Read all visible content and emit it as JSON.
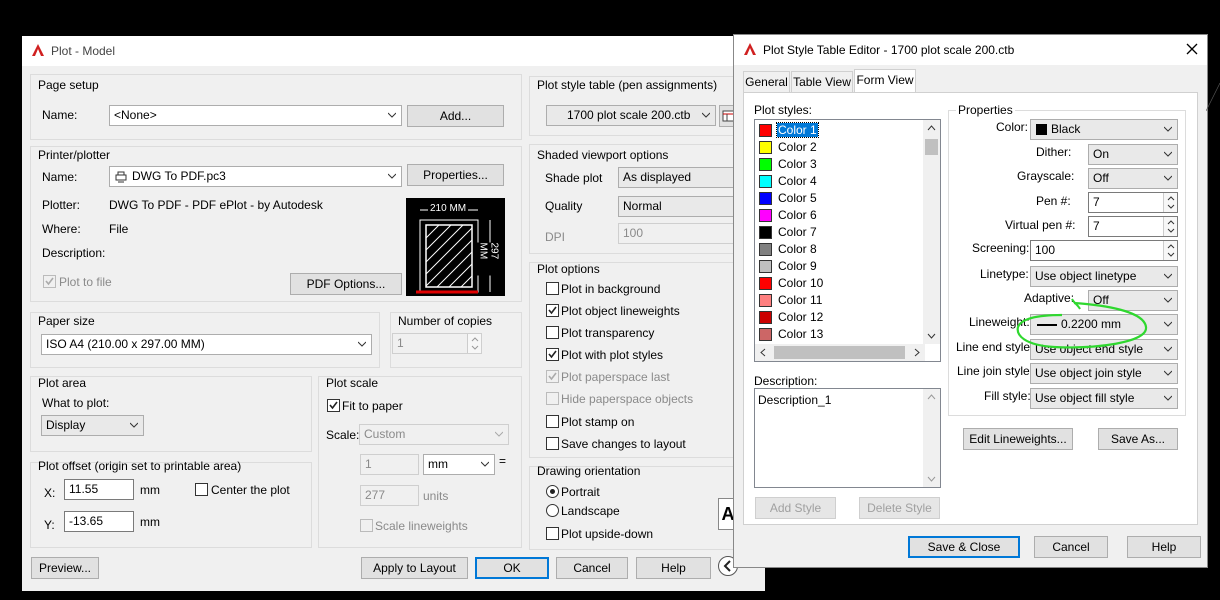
{
  "plot": {
    "title": "Plot - Model",
    "page_setup": {
      "group": "Page setup",
      "name_label": "Name:",
      "name_value": "<None>",
      "add_button": "Add..."
    },
    "printer": {
      "group": "Printer/plotter",
      "name_label": "Name:",
      "name_value": "DWG To PDF.pc3",
      "properties_button": "Properties...",
      "plotter_label": "Plotter:",
      "plotter_value": "DWG To PDF - PDF ePlot - by Autodesk",
      "where_label": "Where:",
      "where_value": "File",
      "description_label": "Description:",
      "plot_to_file_label": "Plot to file",
      "pdf_options_button": "PDF Options...",
      "preview_width": "210 MM",
      "preview_height": "297 MM"
    },
    "paper_size": {
      "group": "Paper size",
      "value": "ISO A4 (210.00 x 297.00 MM)"
    },
    "copies": {
      "group": "Number of copies",
      "value": "1"
    },
    "plot_area": {
      "group": "Plot area",
      "what_label": "What to plot:",
      "what_value": "Display"
    },
    "plot_offset": {
      "group": "Plot offset (origin set to printable area)",
      "x_label": "X:",
      "x_value": "11.55",
      "y_label": "Y:",
      "y_value": "-13.65",
      "unit": "mm",
      "center_label": "Center the plot"
    },
    "plot_scale": {
      "group": "Plot scale",
      "fit_label": "Fit to paper",
      "scale_label": "Scale:",
      "scale_value": "Custom",
      "num_value": "1",
      "unit_value": "mm",
      "equals": "=",
      "den_value": "277",
      "units_label": "units",
      "scale_lw_label": "Scale lineweights"
    },
    "plot_style_table": {
      "group": "Plot style table (pen assignments)",
      "value": "1700 plot scale 200.ctb"
    },
    "shaded": {
      "group": "Shaded viewport options",
      "shade_label": "Shade plot",
      "shade_value": "As displayed",
      "quality_label": "Quality",
      "quality_value": "Normal",
      "dpi_label": "DPI",
      "dpi_value": "100"
    },
    "options": {
      "group": "Plot options",
      "items": [
        {
          "label": "Plot in background",
          "checked": false,
          "disabled": false
        },
        {
          "label": "Plot object lineweights",
          "checked": true,
          "disabled": false
        },
        {
          "label": "Plot transparency",
          "checked": false,
          "disabled": false
        },
        {
          "label": "Plot with plot styles",
          "checked": true,
          "disabled": false
        },
        {
          "label": "Plot paperspace last",
          "checked": true,
          "disabled": true
        },
        {
          "label": "Hide paperspace objects",
          "checked": false,
          "disabled": true
        },
        {
          "label": "Plot stamp on",
          "checked": false,
          "disabled": false
        },
        {
          "label": "Save changes to layout",
          "checked": false,
          "disabled": false
        }
      ]
    },
    "orientation": {
      "group": "Drawing orientation",
      "portrait": "Portrait",
      "landscape": "Landscape",
      "upside": "Plot upside-down"
    },
    "buttons": {
      "preview": "Preview...",
      "apply": "Apply to Layout",
      "ok": "OK",
      "cancel": "Cancel",
      "help": "Help"
    }
  },
  "editor": {
    "title": "Plot Style Table Editor - 1700 plot scale 200.ctb",
    "tabs": [
      "General",
      "Table View",
      "Form View"
    ],
    "plot_styles_label": "Plot styles:",
    "styles": [
      {
        "name": "Color 1",
        "color": "#ff0000"
      },
      {
        "name": "Color 2",
        "color": "#ffff00"
      },
      {
        "name": "Color 3",
        "color": "#00ff00"
      },
      {
        "name": "Color 4",
        "color": "#00ffff"
      },
      {
        "name": "Color 5",
        "color": "#0000ff"
      },
      {
        "name": "Color 6",
        "color": "#ff00ff"
      },
      {
        "name": "Color 7",
        "color": "#000000"
      },
      {
        "name": "Color 8",
        "color": "#808080"
      },
      {
        "name": "Color 9",
        "color": "#c0c0c0"
      },
      {
        "name": "Color 10",
        "color": "#ff0000"
      },
      {
        "name": "Color 11",
        "color": "#ff7f7f"
      },
      {
        "name": "Color 12",
        "color": "#cc0000"
      },
      {
        "name": "Color 13",
        "color": "#cc6666"
      }
    ],
    "description_label": "Description:",
    "description_value": "Description_1",
    "add_style": "Add Style",
    "delete_style": "Delete Style",
    "properties": {
      "group": "Properties",
      "color_label": "Color:",
      "color_value": "Black",
      "dither_label": "Dither:",
      "dither_value": "On",
      "grayscale_label": "Grayscale:",
      "grayscale_value": "Off",
      "pen_label": "Pen #:",
      "pen_value": "7",
      "vpen_label": "Virtual pen #:",
      "vpen_value": "7",
      "screening_label": "Screening:",
      "screening_value": "100",
      "linetype_label": "Linetype:",
      "linetype_value": "Use object linetype",
      "adaptive_label": "Adaptive:",
      "adaptive_value": "Off",
      "lineweight_label": "Lineweight:",
      "lineweight_value": "0.2200 mm",
      "lineend_label": "Line end style:",
      "lineend_value": "Use object end style",
      "linejoin_label": "Line join style:",
      "linejoin_value": "Use object join style",
      "fill_label": "Fill style:",
      "fill_value": "Use object fill style"
    },
    "edit_lineweights": "Edit Lineweights...",
    "save_as": "Save As...",
    "save_close": "Save & Close",
    "cancel": "Cancel",
    "help": "Help"
  },
  "colors": {
    "accent": "#0078d7",
    "highlight": "#00cc00",
    "autocad_red": "#d02020"
  }
}
